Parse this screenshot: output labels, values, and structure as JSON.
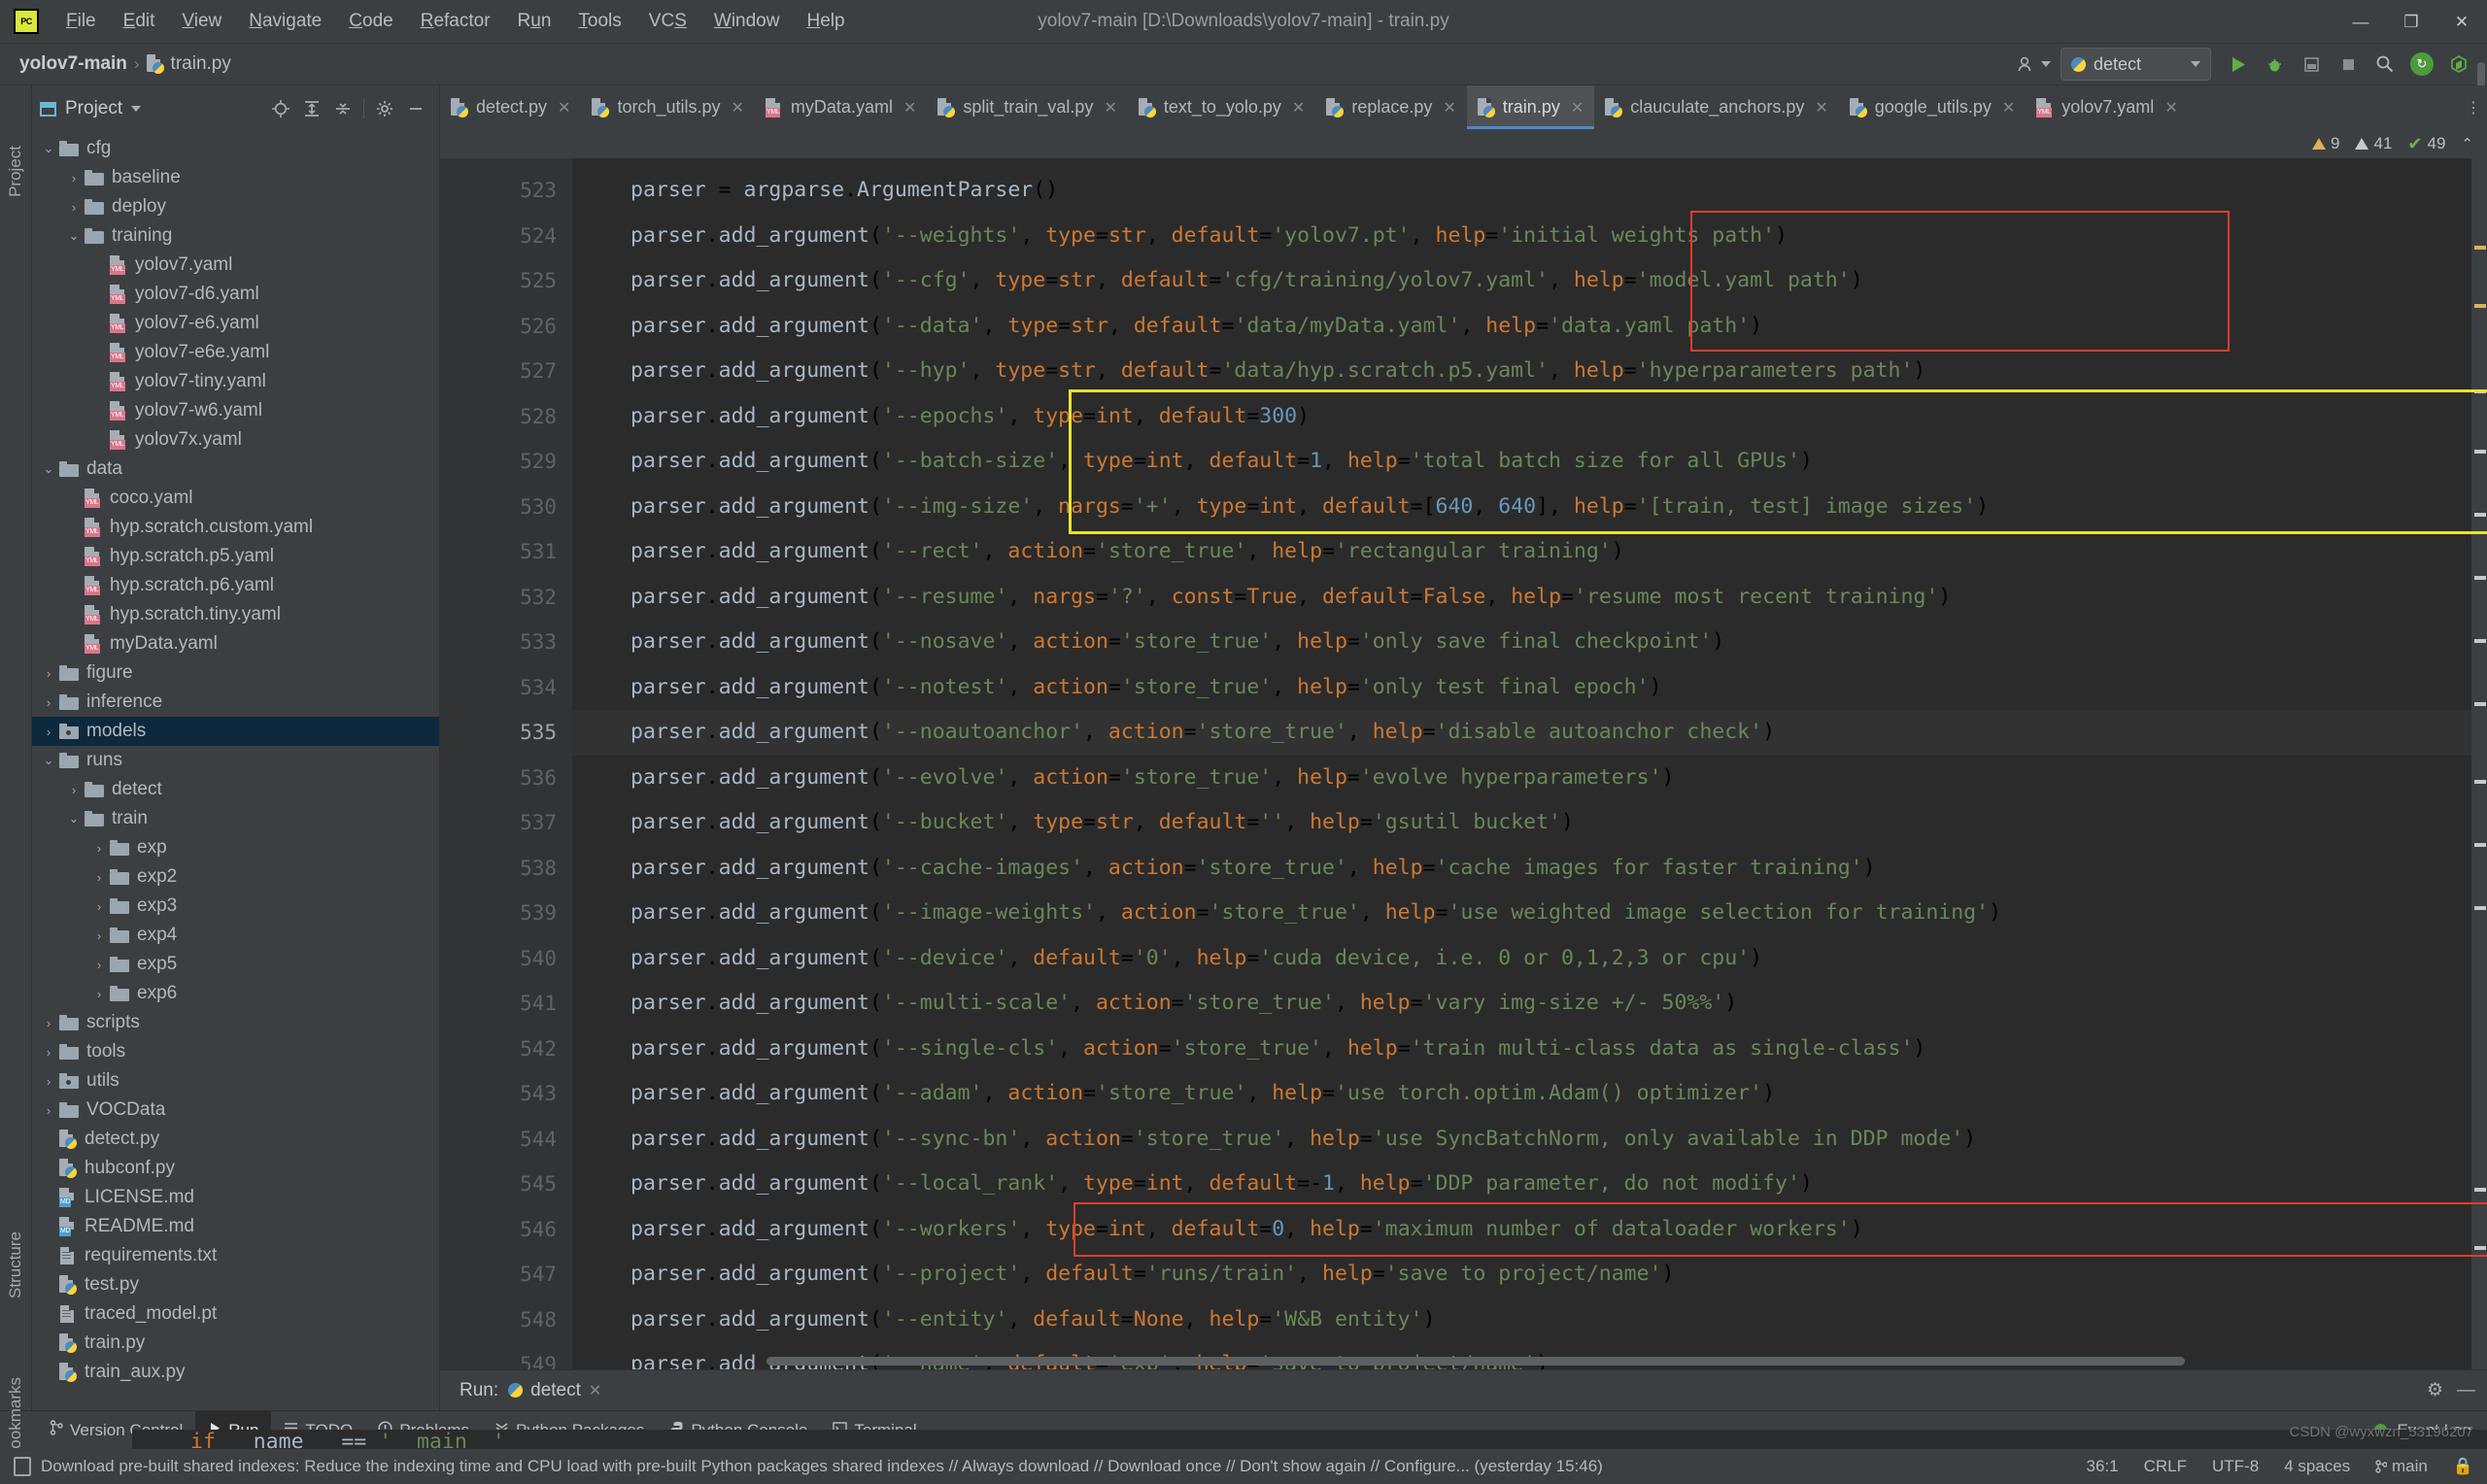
{
  "window": {
    "title": "yolov7-main [D:\\Downloads\\yolov7-main] - train.py",
    "minimize": "—",
    "maximize": "❐",
    "close": "✕",
    "logo_text": "PC"
  },
  "menubar": {
    "items": [
      {
        "label": "File",
        "mnemonic": "F"
      },
      {
        "label": "Edit",
        "mnemonic": "E"
      },
      {
        "label": "View",
        "mnemonic": "V"
      },
      {
        "label": "Navigate",
        "mnemonic": "N"
      },
      {
        "label": "Code",
        "mnemonic": "C"
      },
      {
        "label": "Refactor",
        "mnemonic": "R"
      },
      {
        "label": "Run",
        "mnemonic": "u"
      },
      {
        "label": "Tools",
        "mnemonic": "T"
      },
      {
        "label": "VCS",
        "mnemonic": "S"
      },
      {
        "label": "Window",
        "mnemonic": "W"
      },
      {
        "label": "Help",
        "mnemonic": "H"
      }
    ]
  },
  "breadcrumb": {
    "project": "yolov7-main",
    "separator": "›",
    "file": "train.py"
  },
  "navbar": {
    "run_config": "detect",
    "run_button": "▶",
    "debug_button": "🐞",
    "stop_button": "■",
    "coverage_button": "▥",
    "search_button": "🔍",
    "user_icon": "person-icon",
    "update_icon": "↻",
    "settings_icon": "⚙"
  },
  "left_rail": {
    "project": "Project",
    "structure": "Structure",
    "bookmarks": "Bookmarks"
  },
  "project_panel": {
    "title": "Project",
    "dropdown": "▾",
    "icons": [
      "locate-icon",
      "expand-all-icon",
      "collapse-all-icon",
      "gear-icon",
      "minimize-icon"
    ],
    "tree": [
      {
        "label": "cfg",
        "indent": 1,
        "type": "folder",
        "state": "open"
      },
      {
        "label": "baseline",
        "indent": 2,
        "type": "folder",
        "state": "closed"
      },
      {
        "label": "deploy",
        "indent": 2,
        "type": "folder",
        "state": "closed"
      },
      {
        "label": "training",
        "indent": 2,
        "type": "folder",
        "state": "open"
      },
      {
        "label": "yolov7.yaml",
        "indent": 3,
        "type": "yaml"
      },
      {
        "label": "yolov7-d6.yaml",
        "indent": 3,
        "type": "yaml"
      },
      {
        "label": "yolov7-e6.yaml",
        "indent": 3,
        "type": "yaml"
      },
      {
        "label": "yolov7-e6e.yaml",
        "indent": 3,
        "type": "yaml"
      },
      {
        "label": "yolov7-tiny.yaml",
        "indent": 3,
        "type": "yaml"
      },
      {
        "label": "yolov7-w6.yaml",
        "indent": 3,
        "type": "yaml"
      },
      {
        "label": "yolov7x.yaml",
        "indent": 3,
        "type": "yaml"
      },
      {
        "label": "data",
        "indent": 1,
        "type": "folder",
        "state": "open"
      },
      {
        "label": "coco.yaml",
        "indent": 2,
        "type": "yaml"
      },
      {
        "label": "hyp.scratch.custom.yaml",
        "indent": 2,
        "type": "yaml"
      },
      {
        "label": "hyp.scratch.p5.yaml",
        "indent": 2,
        "type": "yaml"
      },
      {
        "label": "hyp.scratch.p6.yaml",
        "indent": 2,
        "type": "yaml"
      },
      {
        "label": "hyp.scratch.tiny.yaml",
        "indent": 2,
        "type": "yaml"
      },
      {
        "label": "myData.yaml",
        "indent": 2,
        "type": "yaml"
      },
      {
        "label": "figure",
        "indent": 1,
        "type": "folder",
        "state": "closed"
      },
      {
        "label": "inference",
        "indent": 1,
        "type": "folder",
        "state": "closed"
      },
      {
        "label": "models",
        "indent": 1,
        "type": "source",
        "state": "closed",
        "selected": true
      },
      {
        "label": "runs",
        "indent": 1,
        "type": "folder",
        "state": "open"
      },
      {
        "label": "detect",
        "indent": 2,
        "type": "folder",
        "state": "closed"
      },
      {
        "label": "train",
        "indent": 2,
        "type": "folder",
        "state": "open"
      },
      {
        "label": "exp",
        "indent": 3,
        "type": "folder",
        "state": "closed"
      },
      {
        "label": "exp2",
        "indent": 3,
        "type": "folder",
        "state": "closed"
      },
      {
        "label": "exp3",
        "indent": 3,
        "type": "folder",
        "state": "closed"
      },
      {
        "label": "exp4",
        "indent": 3,
        "type": "folder",
        "state": "closed"
      },
      {
        "label": "exp5",
        "indent": 3,
        "type": "folder",
        "state": "closed"
      },
      {
        "label": "exp6",
        "indent": 3,
        "type": "folder",
        "state": "closed"
      },
      {
        "label": "scripts",
        "indent": 1,
        "type": "folder",
        "state": "closed"
      },
      {
        "label": "tools",
        "indent": 1,
        "type": "folder",
        "state": "closed"
      },
      {
        "label": "utils",
        "indent": 1,
        "type": "source",
        "state": "closed"
      },
      {
        "label": "VOCData",
        "indent": 1,
        "type": "folder",
        "state": "closed"
      },
      {
        "label": "detect.py",
        "indent": 1,
        "type": "py"
      },
      {
        "label": "hubconf.py",
        "indent": 1,
        "type": "py"
      },
      {
        "label": "LICENSE.md",
        "indent": 1,
        "type": "md"
      },
      {
        "label": "README.md",
        "indent": 1,
        "type": "md"
      },
      {
        "label": "requirements.txt",
        "indent": 1,
        "type": "txt"
      },
      {
        "label": "test.py",
        "indent": 1,
        "type": "py"
      },
      {
        "label": "traced_model.pt",
        "indent": 1,
        "type": "txt"
      },
      {
        "label": "train.py",
        "indent": 1,
        "type": "py"
      },
      {
        "label": "train_aux.py",
        "indent": 1,
        "type": "py"
      }
    ]
  },
  "editor": {
    "tabs": [
      {
        "label": "detect.py",
        "type": "py",
        "active": false
      },
      {
        "label": "torch_utils.py",
        "type": "py",
        "active": false
      },
      {
        "label": "myData.yaml",
        "type": "yaml",
        "active": false
      },
      {
        "label": "split_train_val.py",
        "type": "py",
        "active": false
      },
      {
        "label": "text_to_yolo.py",
        "type": "py",
        "active": false
      },
      {
        "label": "replace.py",
        "type": "py",
        "active": false
      },
      {
        "label": "train.py",
        "type": "py",
        "active": true
      },
      {
        "label": "clauculate_anchors.py",
        "type": "py",
        "active": false
      },
      {
        "label": "google_utils.py",
        "type": "py",
        "active": false
      },
      {
        "label": "yolov7.yaml",
        "type": "yaml",
        "active": false
      }
    ],
    "tab_close": "✕",
    "tab_overflow": "⋮",
    "inspections": {
      "warnings": "9",
      "weak_warnings": "41",
      "typos": "49",
      "collapse": "⌃"
    },
    "line_start": 523,
    "current_line": 535,
    "lines": [
      {
        "num": 523,
        "text": "parser = argparse.ArgumentParser()"
      },
      {
        "num": 524,
        "text": "parser.add_argument('--weights', type=str, default='yolov7.pt', help='initial weights path')"
      },
      {
        "num": 525,
        "text": "parser.add_argument('--cfg', type=str, default='cfg/training/yolov7.yaml', help='model.yaml path')"
      },
      {
        "num": 526,
        "text": "parser.add_argument('--data', type=str, default='data/myData.yaml', help='data.yaml path')"
      },
      {
        "num": 527,
        "text": "parser.add_argument('--hyp', type=str, default='data/hyp.scratch.p5.yaml', help='hyperparameters path')"
      },
      {
        "num": 528,
        "text": "parser.add_argument('--epochs', type=int, default=300)"
      },
      {
        "num": 529,
        "text": "parser.add_argument('--batch-size', type=int, default=1, help='total batch size for all GPUs')"
      },
      {
        "num": 530,
        "text": "parser.add_argument('--img-size', nargs='+', type=int, default=[640, 640], help='[train, test] image sizes')"
      },
      {
        "num": 531,
        "text": "parser.add_argument('--rect', action='store_true', help='rectangular training')"
      },
      {
        "num": 532,
        "text": "parser.add_argument('--resume', nargs='?', const=True, default=False, help='resume most recent training')"
      },
      {
        "num": 533,
        "text": "parser.add_argument('--nosave', action='store_true', help='only save final checkpoint')"
      },
      {
        "num": 534,
        "text": "parser.add_argument('--notest', action='store_true', help='only test final epoch')"
      },
      {
        "num": 535,
        "text": "parser.add_argument('--noautoanchor', action='store_true', help='disable autoanchor check')"
      },
      {
        "num": 536,
        "text": "parser.add_argument('--evolve', action='store_true', help='evolve hyperparameters')"
      },
      {
        "num": 537,
        "text": "parser.add_argument('--bucket', type=str, default='', help='gsutil bucket')"
      },
      {
        "num": 538,
        "text": "parser.add_argument('--cache-images', action='store_true', help='cache images for faster training')"
      },
      {
        "num": 539,
        "text": "parser.add_argument('--image-weights', action='store_true', help='use weighted image selection for training')"
      },
      {
        "num": 540,
        "text": "parser.add_argument('--device', default='0', help='cuda device, i.e. 0 or 0,1,2,3 or cpu')"
      },
      {
        "num": 541,
        "text": "parser.add_argument('--multi-scale', action='store_true', help='vary img-size +/- 50%%')"
      },
      {
        "num": 542,
        "text": "parser.add_argument('--single-cls', action='store_true', help='train multi-class data as single-class')"
      },
      {
        "num": 543,
        "text": "parser.add_argument('--adam', action='store_true', help='use torch.optim.Adam() optimizer')"
      },
      {
        "num": 544,
        "text": "parser.add_argument('--sync-bn', action='store_true', help='use SyncBatchNorm, only available in DDP mode')"
      },
      {
        "num": 545,
        "text": "parser.add_argument('--local_rank', type=int, default=-1, help='DDP parameter, do not modify')"
      },
      {
        "num": 546,
        "text": "parser.add_argument('--workers', type=int, default=0, help='maximum number of dataloader workers')"
      },
      {
        "num": 547,
        "text": "parser.add_argument('--project', default='runs/train', help='save to project/name')"
      },
      {
        "num": 548,
        "text": "parser.add_argument('--entity', default=None, help='W&B entity')"
      },
      {
        "num": 549,
        "text": "parser.add_argument('--name', default='exp', help='save to project/name')"
      }
    ],
    "footer_line": "if __name__ == '__main__'",
    "annotations": [
      {
        "color": "#e23c2e",
        "lines": "524-526",
        "label": "weights-cfg-data-highlight"
      },
      {
        "color": "#e8e236",
        "lines": "528-530",
        "label": "epochs-batch-imgsize-highlight"
      },
      {
        "color": "#e23c2e",
        "lines": "546",
        "label": "workers-highlight"
      }
    ]
  },
  "run_panel": {
    "label": "Run:",
    "config_name": "detect",
    "close": "✕",
    "settings_icon": "⚙",
    "minimize_icon": "—"
  },
  "bottom_toolbar": {
    "items": [
      {
        "label": "Version Control",
        "icon": "branch-icon",
        "active": false
      },
      {
        "label": "Run",
        "icon": "play-icon",
        "active": true
      },
      {
        "label": "TODO",
        "icon": "list-icon",
        "active": false
      },
      {
        "label": "Problems",
        "icon": "warning-icon",
        "active": false
      },
      {
        "label": "Python Packages",
        "icon": "packages-icon",
        "active": false
      },
      {
        "label": "Python Console",
        "icon": "python-icon",
        "active": false
      },
      {
        "label": "Terminal",
        "icon": "terminal-icon",
        "active": false
      }
    ],
    "event_log": "Event Log"
  },
  "statusbar": {
    "message": "Download pre-built shared indexes: Reduce the indexing time and CPU load with pre-built Python packages shared indexes // Always download // Download once // Don't show again // Configure... (yesterday 15:46)",
    "caret": "36:1",
    "line_sep": "CRLF",
    "encoding": "UTF-8",
    "indent": "4 spaces",
    "branch": "main",
    "watermark": "CSDN @wyxwzn_53196207"
  },
  "colors": {
    "bg": "#3c3f41",
    "editor_bg": "#2b2b2b",
    "gutter_bg": "#313335",
    "accent": "#4a88c7",
    "selection": "#0d293e",
    "annotation_red": "#e23c2e",
    "annotation_yellow": "#e8e236",
    "string": "#6a8759",
    "keyword": "#cc7832",
    "number": "#6897bb",
    "ident": "#a9b7c6"
  }
}
